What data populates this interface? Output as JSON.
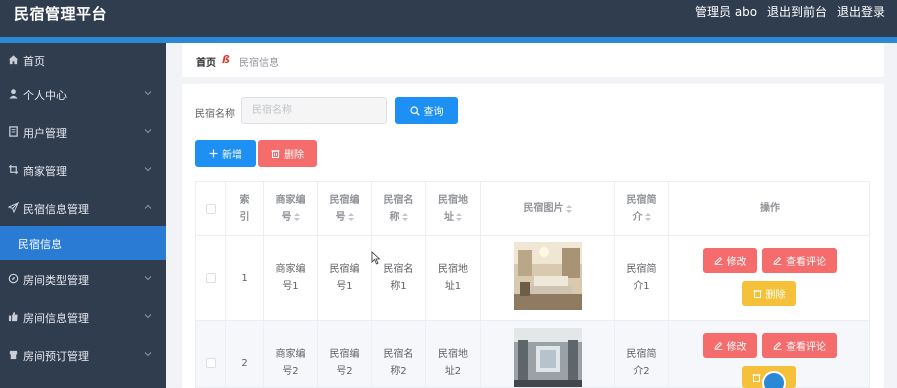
{
  "header": {
    "title": "民宿管理平台",
    "admin": "管理员 abo",
    "exit_front": "退出到前台",
    "logout": "退出登录"
  },
  "sidebar": {
    "items": [
      {
        "label": "首页",
        "icon": "home-icon"
      },
      {
        "label": "个人中心",
        "icon": "user-icon"
      },
      {
        "label": "用户管理",
        "icon": "list-icon"
      },
      {
        "label": "商家管理",
        "icon": "crop-icon"
      },
      {
        "label": "民宿信息管理",
        "icon": "send-icon"
      },
      {
        "label": "民宿信息",
        "icon": ""
      },
      {
        "label": "房间类型管理",
        "icon": "compass-icon"
      },
      {
        "label": "房间信息管理",
        "icon": "thumb-icon"
      },
      {
        "label": "房间预订管理",
        "icon": "phone-icon"
      }
    ]
  },
  "breadcrumb": {
    "home": "首页",
    "separator": "ß",
    "current": "民宿信息"
  },
  "search": {
    "label": "民宿名称",
    "placeholder": "民宿名称",
    "button": "查询"
  },
  "actions": {
    "add": "新增",
    "delete": "删除"
  },
  "table": {
    "headers": [
      "",
      "索引",
      "商家编号",
      "民宿编号",
      "民宿名称",
      "民宿地址",
      "民宿图片",
      "民宿简介",
      "操作"
    ],
    "rows": [
      {
        "index": "1",
        "merchant_no": "商家编号1",
        "homestay_no": "民宿编号1",
        "name": "民宿名称1",
        "address": "民宿地址1",
        "intro": "民宿简介1"
      },
      {
        "index": "2",
        "merchant_no": "商家编号2",
        "homestay_no": "民宿编号2",
        "name": "民宿名称2",
        "address": "民宿地址2",
        "intro": "民宿简介2"
      }
    ],
    "row_actions": {
      "edit": "修改",
      "reviews": "查看评论",
      "delete": "删除"
    }
  },
  "colors": {
    "topbar": "#2f3d4f",
    "accent": "#2a88d6",
    "primary": "#1e90f3",
    "danger": "#f56c6c",
    "warning": "#f5c03a"
  }
}
